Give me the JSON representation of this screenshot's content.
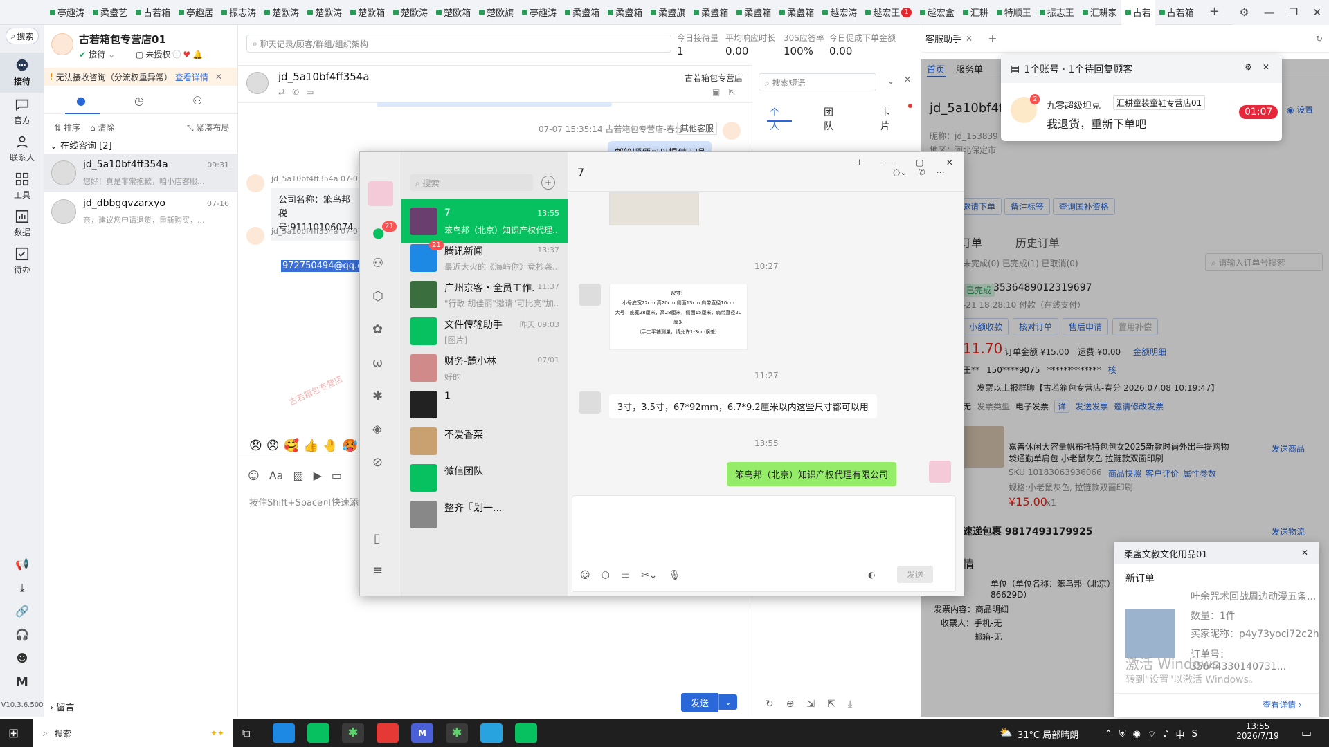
{
  "tabs": [
    "亭趣涛",
    "柔盏艺",
    "古若箱",
    "亭趣居",
    "振志涛",
    "楚欧涛",
    "楚欧涛",
    "楚欧箱",
    "楚欧涛",
    "楚欧箱",
    "楚欧旗",
    "亭趣涛",
    "柔盏箱",
    "柔盏箱",
    "柔盏旗",
    "柔盏箱",
    "柔盏箱",
    "柔盏箱",
    "越宏涛",
    "越宏王",
    "越宏盒",
    "汇耕",
    "特顺王",
    "振志王",
    "汇耕家",
    "古若",
    "古若箱"
  ],
  "tab_badge": "1",
  "rail": {
    "search": "搜索",
    "reception": "接待",
    "official": "官方",
    "contacts": "联系人",
    "tools": "工具",
    "data": "数据",
    "todo": "待办",
    "version": "V10.3.6.500"
  },
  "shop": {
    "name": "古若箱包专营店01",
    "status": "接待",
    "auth": "未授权",
    "warn": "无法接收咨询（分流权重异常）",
    "warn_link": "查看详情"
  },
  "list_tools": {
    "sort": "排序",
    "clear": "清除",
    "compact": "紧凑布局"
  },
  "online": "在线咨询 [2]",
  "convs": [
    {
      "name": "jd_5a10bf4ff354a",
      "time": "09:31",
      "preview": "您好！真是非常抱歉，咱小店客服..."
    },
    {
      "name": "jd_dbbgqvzarxyo",
      "time": "07-16",
      "preview": "亲，建议您申请退货，重新购买，..."
    }
  ],
  "leave_msg": "留言",
  "chat": {
    "search_placeholder": "聊天记录/顾客/群组/组织架构",
    "stats": [
      {
        "label": "今日接待量",
        "value": "1"
      },
      {
        "label": "平均响应时长",
        "value": "0.00"
      },
      {
        "label": "30S应答率",
        "value": "100%"
      },
      {
        "label": "今日促成下单金额",
        "value": "0.00"
      }
    ],
    "customer": "jd_5a10bf4ff354a",
    "shop_tag": "古若箱包专营店",
    "msg_time": "07-07 15:35:14 古若箱包专营店-春分",
    "other_cs": "其他客服",
    "bubble_top": "邮箱顺便可以提供下呢",
    "sender1": "jd_5a10bf4ff354a 07-07",
    "company": "公司名称：笨鸟邦",
    "tax": "税号:91110106074",
    "sender2": "jd_5a10bf4ff354a 07-07",
    "email": "972750494@qq.co",
    "watermark": "古若箱包专营店",
    "input_hint": "按住Shift+Space可快速添",
    "send": "发送"
  },
  "quick": {
    "search_placeholder": "搜索短语",
    "tabs": [
      "个人",
      "团队",
      "卡片"
    ]
  },
  "cust": {
    "tab_home": "首页",
    "tab_service": "服务单",
    "helper": "客服助手",
    "setting": "设置",
    "name": "jd_5a10bf4ff",
    "nick": "昵称：jd_153839",
    "region": "地区：河北保定市",
    "btn_invite": "邀请下单",
    "btn_note": "备注标签",
    "btn_subsidy": "查询国补资格",
    "orders": "订单",
    "history": "历史订单",
    "order_search": "请输入订单号搜索",
    "filters": "未完成(0)  已完成(1)  已取消(0)",
    "order_status": "已完成",
    "order_no": "3536489012319697",
    "order_time": "-21 18:28:10 付款（在线支付）",
    "actions": [
      "小额收款",
      "核对订单",
      "售后申请",
      "置用补偿"
    ],
    "price": "11.70",
    "order_amount": "订单金额 ¥15.00",
    "freight": "运费 ¥0.00",
    "detail_link": "金额明细",
    "buyer": "王**",
    "phone": "150****9075",
    "addr": "*************",
    "verify": "核",
    "invoice": "发票以上报群聊【古若箱包专营店-春分 2026.07.08 10:19:47】",
    "invoice_type_label": "发票类型",
    "invoice_type": "电子发票",
    "detail_btn": "详",
    "send_invoice": "发送发票",
    "invite_modify": "邀请修改发票",
    "product": "嘉善休闲大容量帆布托特包包女2025新款时尚外出手提购物袋通勤单肩包 小老鼠灰色 拉链款双面印刷",
    "sku": "SKU 10183063936066",
    "sku_links": [
      "商品快照",
      "客户评价",
      "属性参数"
    ],
    "spec": "规格:小老鼠灰色, 拉链款双面印刷",
    "unit_price": "¥15.00",
    "qty": "x1",
    "send_goods": "发送商品",
    "express": "速递包裹 9817493179925",
    "send_logistics": "发送物流",
    "detail_title": "情",
    "invoice_unit": "单位（单位名称：笨鸟邦（北京）知识",
    "invoice_unit2": "86629D）",
    "content_label": "发票内容：商品明细",
    "receiver": "收票人：手机-无",
    "email_row": "邮箱-无",
    "none1": "无"
  },
  "notify": {
    "title": "1个账号 · 1个待回复顾客",
    "name": "九零超级坦克",
    "store": "汇耕童装童鞋专营店01",
    "msg": "我退货，重新下单吧",
    "timer": "01:07",
    "badge": "2"
  },
  "order_pop": {
    "title": "柔盏文教文化用品01",
    "subtitle": "新订单",
    "product": "叶余咒术回战周边动漫五条...",
    "qty": "数量：1件",
    "buyer": "买家昵称：p4y73yoci72c2h",
    "order": "订单号：35644330140731...",
    "link": "查看详情"
  },
  "activate": {
    "line1": "激活 Windows",
    "line2": "转到\"设置\"以激活 Windows。"
  },
  "wechat": {
    "search": "搜索",
    "side_badge": "21",
    "items": [
      {
        "name": "7",
        "time": "13:55",
        "preview": "笨鸟邦（北京）知识产权代理..."
      },
      {
        "name": "腾讯新闻",
        "time": "13:37",
        "preview": "最近大火的《海屿你》竟抄袭...",
        "badge": "21"
      },
      {
        "name": "广州京客・全员工作...",
        "time": "11:37",
        "preview": "\"行政 胡佳丽\"邀请\"可比亮\"加..."
      },
      {
        "name": "文件传输助手",
        "time": "昨天 09:03",
        "preview": "[图片]"
      },
      {
        "name": "财务-麓小林",
        "time": "07/01",
        "preview": "好的"
      },
      {
        "name": "1",
        "time": "",
        "preview": ""
      },
      {
        "name": "不爱香菜",
        "time": "",
        "preview": ""
      },
      {
        "name": "微信团队",
        "time": "",
        "preview": ""
      },
      {
        "name": "整齐『划一...",
        "time": "",
        "preview": ""
      }
    ],
    "chat_title": "7",
    "t1": "10:27",
    "t2": "11:27",
    "t3": "13:55",
    "size_card": {
      "title": "尺寸：",
      "l1": "小号底宽22cm 高20cm 侧面13cm 肩带直径10cm",
      "l2": "大号：底宽28厘米，高28厘米，侧面15厘米，肩带直径20厘米",
      "l3": "（手工平铺测量，请允许1-3cm误差）"
    },
    "msg_in": "3寸，3.5寸，67*92mm，6.7*9.2厘米以内这些尺寸都可以用",
    "msg_out": "笨鸟邦（北京）知识产权代理有限公司",
    "send": "发送"
  },
  "taskbar": {
    "search": "搜索",
    "weather": "31°C  局部晴朗",
    "time": "13:55",
    "date": "2026/7/19",
    "ime": "中"
  }
}
